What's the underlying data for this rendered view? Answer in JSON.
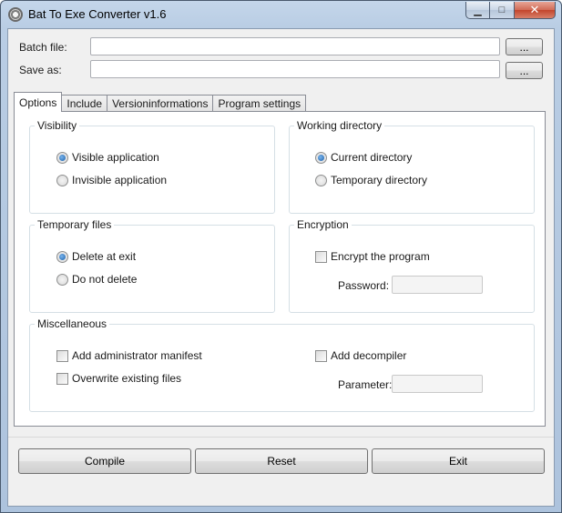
{
  "window": {
    "title": "Bat To Exe Converter v1.6",
    "icons": {
      "app": "gear-icon",
      "minimize": "minimize-icon",
      "maximize": "maximize-icon",
      "close": "close-icon"
    },
    "minimize_glyph": "▁",
    "maximize_glyph": "□",
    "close_glyph": "✕"
  },
  "files": {
    "batch_label": "Batch file:",
    "batch_value": "",
    "save_label": "Save as:",
    "save_value": "",
    "browse_label": "..."
  },
  "tabs": [
    {
      "label": "Options",
      "active": true
    },
    {
      "label": "Include",
      "active": false
    },
    {
      "label": "Versioninformations",
      "active": false
    },
    {
      "label": "Program settings",
      "active": false
    }
  ],
  "visibility": {
    "title": "Visibility",
    "visible": {
      "label": "Visible application",
      "checked": true
    },
    "invisible": {
      "label": "Invisible application",
      "checked": false
    }
  },
  "working_directory": {
    "title": "Working directory",
    "current": {
      "label": "Current directory",
      "checked": true
    },
    "temporary": {
      "label": "Temporary directory",
      "checked": false
    }
  },
  "temporary_files": {
    "title": "Temporary files",
    "delete": {
      "label": "Delete at exit",
      "checked": true
    },
    "keep": {
      "label": "Do not delete",
      "checked": false
    }
  },
  "encryption": {
    "title": "Encryption",
    "encrypt": {
      "label": "Encrypt the program",
      "checked": false
    },
    "password_label": "Password:",
    "password_value": ""
  },
  "misc": {
    "title": "Miscellaneous",
    "admin_manifest": {
      "label": "Add administrator manifest",
      "checked": false
    },
    "overwrite": {
      "label": "Overwrite existing files",
      "checked": false
    },
    "decompiler": {
      "label": "Add decompiler",
      "checked": false
    },
    "parameter_label": "Parameter:",
    "parameter_value": ""
  },
  "actions": {
    "compile": "Compile",
    "reset": "Reset",
    "exit": "Exit"
  },
  "colors": {
    "title_bar": "#b9cde4",
    "close_button": "#c2452c",
    "radio_dot": "#1a5fa8"
  }
}
